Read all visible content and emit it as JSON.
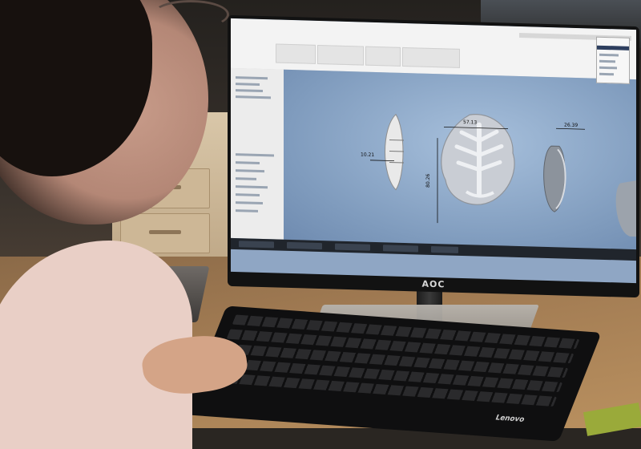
{
  "monitor": {
    "brand": "AOC"
  },
  "keyboard": {
    "brand": "Lenovo"
  },
  "cad": {
    "dimensions": [
      "57.13",
      "26.39",
      "10.21",
      "80.26"
    ]
  },
  "colors": {
    "viewport": "#8fa6c4",
    "desk": "#a07a52"
  }
}
